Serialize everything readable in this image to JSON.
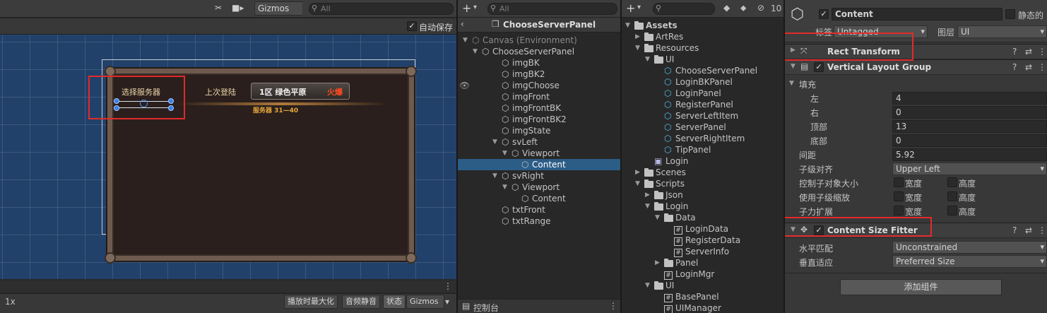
{
  "scene": {
    "gizmos_label": "Gizmos",
    "search_placeholder": "All",
    "autosave_label": "自动保存",
    "autosave_checked": "✓",
    "game": {
      "tab_select_server": "选择服务器",
      "last_login_label": "上次登陆",
      "server_name": "1区 绿色平原",
      "server_status": "火爆",
      "server_range": "服务器 31—40"
    },
    "bottom": {
      "scale": "1x",
      "maximize_on_play": "播放时最大化",
      "mute_audio": "音频静音",
      "stats": "状态",
      "gizmos": "Gizmos",
      "more": "⋮"
    }
  },
  "hierarchy": {
    "add_label": "+",
    "search_placeholder": "All",
    "root_title": "ChooseServerPanel",
    "items": [
      {
        "label": "Canvas (Environment)",
        "arrow": "▼",
        "icon": "cube-icon"
      },
      {
        "label": "ChooseServerPanel",
        "arrow": "▼",
        "icon": "cube-icon"
      },
      {
        "label": "imgBK",
        "arrow": "",
        "icon": "cube-icon"
      },
      {
        "label": "imgBK2",
        "arrow": "",
        "icon": "cube-icon"
      },
      {
        "label": "imgChoose",
        "arrow": "",
        "icon": "cube-icon"
      },
      {
        "label": "imgFront",
        "arrow": "",
        "icon": "cube-icon"
      },
      {
        "label": "imgFrontBK",
        "arrow": "",
        "icon": "cube-icon"
      },
      {
        "label": "imgFrontBK2",
        "arrow": "",
        "icon": "cube-icon"
      },
      {
        "label": "imgState",
        "arrow": "",
        "icon": "cube-icon"
      },
      {
        "label": "svLeft",
        "arrow": "▼",
        "icon": "cube-icon"
      },
      {
        "label": "Viewport",
        "arrow": "▼",
        "icon": "cube-icon"
      },
      {
        "label": "Content",
        "arrow": "",
        "icon": "cube-icon"
      },
      {
        "label": "svRight",
        "arrow": "▼",
        "icon": "cube-icon"
      },
      {
        "label": "Viewport",
        "arrow": "▼",
        "icon": "cube-icon"
      },
      {
        "label": "Content",
        "arrow": "",
        "icon": "cube-icon"
      },
      {
        "label": "txtFront",
        "arrow": "",
        "icon": "cube-icon"
      },
      {
        "label": "txtRange",
        "arrow": "",
        "icon": "cube-icon"
      }
    ],
    "console_label": "控制台",
    "more": "⋮"
  },
  "project": {
    "add_label": "+",
    "hidden_count": "10",
    "items": [
      {
        "label": "Assets",
        "arrow": "▼",
        "icon": "folder-icon"
      },
      {
        "label": "ArtRes",
        "arrow": "▶",
        "icon": "folder-icon"
      },
      {
        "label": "Resources",
        "arrow": "▼",
        "icon": "folder-icon"
      },
      {
        "label": "UI",
        "arrow": "▼",
        "icon": "folder-icon"
      },
      {
        "label": "ChooseServerPanel",
        "arrow": "",
        "icon": "prefab-icon"
      },
      {
        "label": "LoginBKPanel",
        "arrow": "",
        "icon": "prefab-icon"
      },
      {
        "label": "LoginPanel",
        "arrow": "",
        "icon": "prefab-icon"
      },
      {
        "label": "RegisterPanel",
        "arrow": "",
        "icon": "prefab-icon"
      },
      {
        "label": "ServerLeftItem",
        "arrow": "",
        "icon": "prefab-icon"
      },
      {
        "label": "ServerPanel",
        "arrow": "",
        "icon": "prefab-icon"
      },
      {
        "label": "ServerRightItem",
        "arrow": "",
        "icon": "prefab-icon"
      },
      {
        "label": "TipPanel",
        "arrow": "",
        "icon": "prefab-icon"
      },
      {
        "label": "Login",
        "arrow": "",
        "icon": "scene-icon"
      },
      {
        "label": "Scenes",
        "arrow": "▶",
        "icon": "folder-icon"
      },
      {
        "label": "Scripts",
        "arrow": "▼",
        "icon": "folder-icon"
      },
      {
        "label": "Json",
        "arrow": "▶",
        "icon": "folder-icon"
      },
      {
        "label": "Login",
        "arrow": "▼",
        "icon": "folder-icon"
      },
      {
        "label": "Data",
        "arrow": "▼",
        "icon": "folder-icon"
      },
      {
        "label": "LoginData",
        "arrow": "",
        "icon": "script-icon"
      },
      {
        "label": "RegisterData",
        "arrow": "",
        "icon": "script-icon"
      },
      {
        "label": "ServerInfo",
        "arrow": "",
        "icon": "script-icon"
      },
      {
        "label": "Panel",
        "arrow": "▶",
        "icon": "folder-icon"
      },
      {
        "label": "LoginMgr",
        "arrow": "",
        "icon": "script-icon"
      },
      {
        "label": "UI",
        "arrow": "▼",
        "icon": "folder-icon"
      },
      {
        "label": "BasePanel",
        "arrow": "",
        "icon": "script-icon"
      },
      {
        "label": "UIManager",
        "arrow": "",
        "icon": "script-icon"
      }
    ]
  },
  "inspector": {
    "object_name": "Content",
    "static_label": "静态的",
    "tag_label": "标签",
    "tag_value": "Untagged",
    "layer_label": "图层",
    "layer_value": "UI",
    "rect_transform": "Rect Transform",
    "vlg": {
      "title": "Vertical Layout Group",
      "padding_label": "填充",
      "left_label": "左",
      "left_value": "4",
      "right_label": "右",
      "right_value": "0",
      "top_label": "顶部",
      "top_value": "13",
      "bottom_label": "底部",
      "bottom_value": "0",
      "spacing_label": "间距",
      "spacing_value": "5.92",
      "alignment_label": "子级对齐",
      "alignment_value": "Upper Left",
      "control_size_label": "控制子对象大小",
      "use_scale_label": "使用子级缩放",
      "force_expand_label": "子力扩展",
      "width_label": "宽度",
      "height_label": "高度"
    },
    "csf": {
      "title": "Content Size Fitter",
      "horizontal_label": "水平匹配",
      "horizontal_value": "Unconstrained",
      "vertical_label": "垂直适应",
      "vertical_value": "Preferred Size"
    },
    "add_component": "添加组件"
  }
}
